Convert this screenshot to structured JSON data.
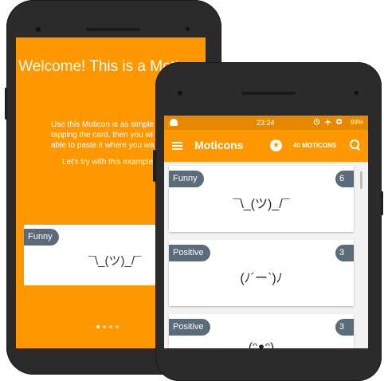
{
  "intro": {
    "title": "Welcome! This is a Moticon",
    "line1": "Use this Moticon is as simple",
    "line2": "tapping the card, then you wi",
    "line3": "able to paste it where you wa",
    "try": "Let's try with this example",
    "card": {
      "tag": "Funny",
      "face": "¯\\_(ツ)_/¯"
    },
    "pager_pages": 4,
    "pager_active": 1
  },
  "status": {
    "time": "23:24",
    "battery": "99%"
  },
  "toolbar": {
    "title": "Moticons",
    "count": "40 MOTICONS"
  },
  "cards": [
    {
      "tag": "Funny",
      "count": "6",
      "face": "¯\\_(ツ)_/¯"
    },
    {
      "tag": "Positive",
      "count": "3",
      "face": "(ﾉ´ー`)ﾉ"
    },
    {
      "tag": "Positive",
      "count": "3",
      "face": "(ᵔᴥᵔ)"
    }
  ],
  "colors": {
    "accent": "#ff9800",
    "status_bar": "#e68900",
    "tag": "#5a6b79"
  }
}
